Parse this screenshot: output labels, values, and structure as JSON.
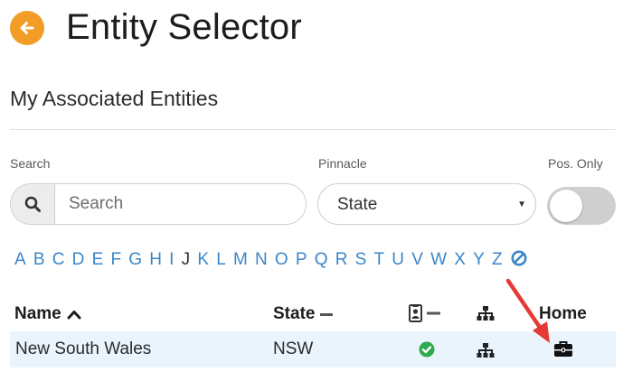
{
  "header": {
    "title": "Entity Selector",
    "back_icon": "arrow-left-icon",
    "accent_color": "#f39c26"
  },
  "section": {
    "title": "My Associated Entities"
  },
  "filters": {
    "search_label": "Search",
    "search_placeholder": "Search",
    "search_value": "",
    "pinnacle_label": "Pinnacle",
    "pinnacle_value": "State",
    "pos_only_label": "Pos. Only",
    "pos_only_on": false
  },
  "alphabet": {
    "letters": [
      "A",
      "B",
      "C",
      "D",
      "E",
      "F",
      "G",
      "H",
      "I",
      "J",
      "K",
      "L",
      "M",
      "N",
      "O",
      "P",
      "Q",
      "R",
      "S",
      "T",
      "U",
      "V",
      "W",
      "X",
      "Y",
      "Z"
    ],
    "active": "J",
    "link_color": "#3a86c8",
    "clear_icon": "ban-icon"
  },
  "table": {
    "columns": {
      "name": "Name",
      "state": "State",
      "badge_icon": "id-badge-icon",
      "hierarchy_icon": "sitemap-icon",
      "home": "Home"
    },
    "sort": {
      "column": "Name",
      "direction": "ascending"
    },
    "rows": [
      {
        "name": "New South Wales",
        "state": "NSW",
        "positions_icon": "check-circle-icon",
        "hierarchy_icon": "sitemap-icon",
        "home_icon": "briefcase-icon",
        "row_color": "#e9f4fd"
      }
    ]
  },
  "annotation": {
    "arrow_color": "#e53935",
    "arrow_icon": "annotation-arrow"
  }
}
